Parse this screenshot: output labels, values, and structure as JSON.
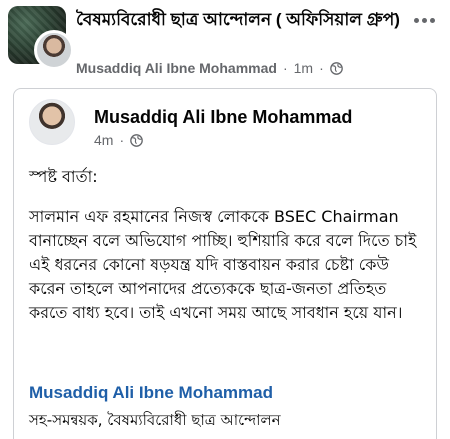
{
  "post": {
    "group_name": "বৈষম্যবিরোধী ছাত্র আন্দোলন ( অফিসিয়াল গ্রুপ)",
    "author": "Musaddiq Ali Ibne Mohammad",
    "time": "1m",
    "separator": "·",
    "privacy_icon": "globe-icon",
    "more_icon": "more-options-icon"
  },
  "shared_post": {
    "author": "Musaddiq Ali Ibne Mohammad",
    "time": "4m",
    "separator": "·",
    "privacy_icon": "globe-icon",
    "heading": "স্পষ্ট বার্তা:",
    "body": "সালমান এফ রহমানের নিজস্ব লোককে BSEC Chairman বানাচ্ছেন বলে অভিযোগ পাচ্ছি। হুশিয়ারি করে বলে দিতে চাই এই ধরনের কোনো ষড়যন্ত্র যদি বাস্তবায়ন করার চেষ্টা কেউ করেন তাহলে আপনাদের প্রত্যেককে ছাত্র-জনতা প্রতিহত করতে বাধ্য হবে। তাই এখনো সময় আছে সাবধান হয়ে যান।",
    "signature_name": "Musaddiq Ali Ibne Mohammad",
    "signature_role": "সহ-সমন্বয়ক, বৈষম্যবিরোধী ছাত্র আন্দোলন"
  },
  "colors": {
    "link_blue": "#1f5fa8",
    "meta_gray": "#65676b",
    "border": "#ced0d4"
  }
}
